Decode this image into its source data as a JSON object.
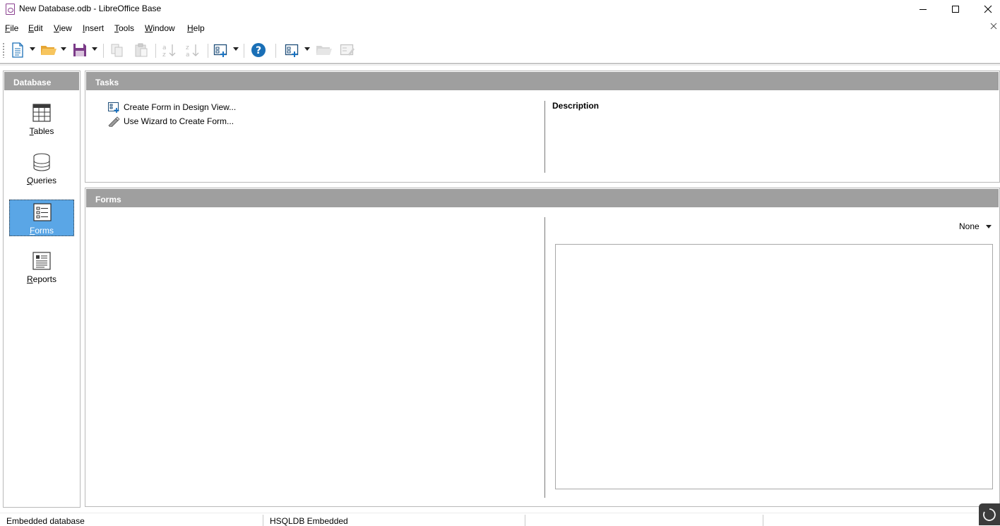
{
  "window": {
    "title": "New Database.odb - LibreOffice Base"
  },
  "menu": [
    {
      "label": "File",
      "accel": "F",
      "rest": "ile"
    },
    {
      "label": "Edit",
      "accel": "E",
      "rest": "dit"
    },
    {
      "label": "View",
      "accel": "V",
      "rest": "iew"
    },
    {
      "label": "Insert",
      "accel": "I",
      "rest": "nsert"
    },
    {
      "label": "Tools",
      "accel": "T",
      "rest": "ools"
    },
    {
      "label": "Window",
      "accel": "W",
      "rest": "indow"
    },
    {
      "label": "Help",
      "accel": "H",
      "rest": "elp"
    }
  ],
  "toolbar": {
    "icons": [
      "new-document-icon",
      "open-folder-icon",
      "save-icon",
      "copy-icon",
      "paste-icon",
      "sort-ascending-icon",
      "sort-descending-icon",
      "form-icon",
      "help-icon",
      "form-design-icon",
      "open-object-icon",
      "edit-object-icon"
    ]
  },
  "database_panel": {
    "header": "Database",
    "items": [
      {
        "label": "Tables",
        "accel": "T",
        "rest": "ables",
        "icon": "table-icon",
        "selected": false
      },
      {
        "label": "Queries",
        "accel": "Q",
        "rest": "ueries",
        "icon": "database-icon",
        "selected": false
      },
      {
        "label": "Forms",
        "accel": "F",
        "rest": "orms",
        "icon": "form-icon",
        "selected": true
      },
      {
        "label": "Reports",
        "accel": "R",
        "rest": "eports",
        "icon": "report-icon",
        "selected": false
      }
    ]
  },
  "tasks_panel": {
    "header": "Tasks",
    "items": [
      {
        "label": "Create Form in Design View...",
        "icon": "form-design-icon"
      },
      {
        "label": "Use Wizard to Create Form...",
        "icon": "wizard-wand-icon"
      }
    ],
    "description_title": "Description"
  },
  "forms_panel": {
    "header": "Forms",
    "preview_mode": "None"
  },
  "statusbar": {
    "left": "Embedded database",
    "middle": "HSQLDB Embedded"
  },
  "colors": {
    "panel_header": "#9f9f9f",
    "selection": "#5aa6e6",
    "accent_blue": "#1a73c2"
  }
}
